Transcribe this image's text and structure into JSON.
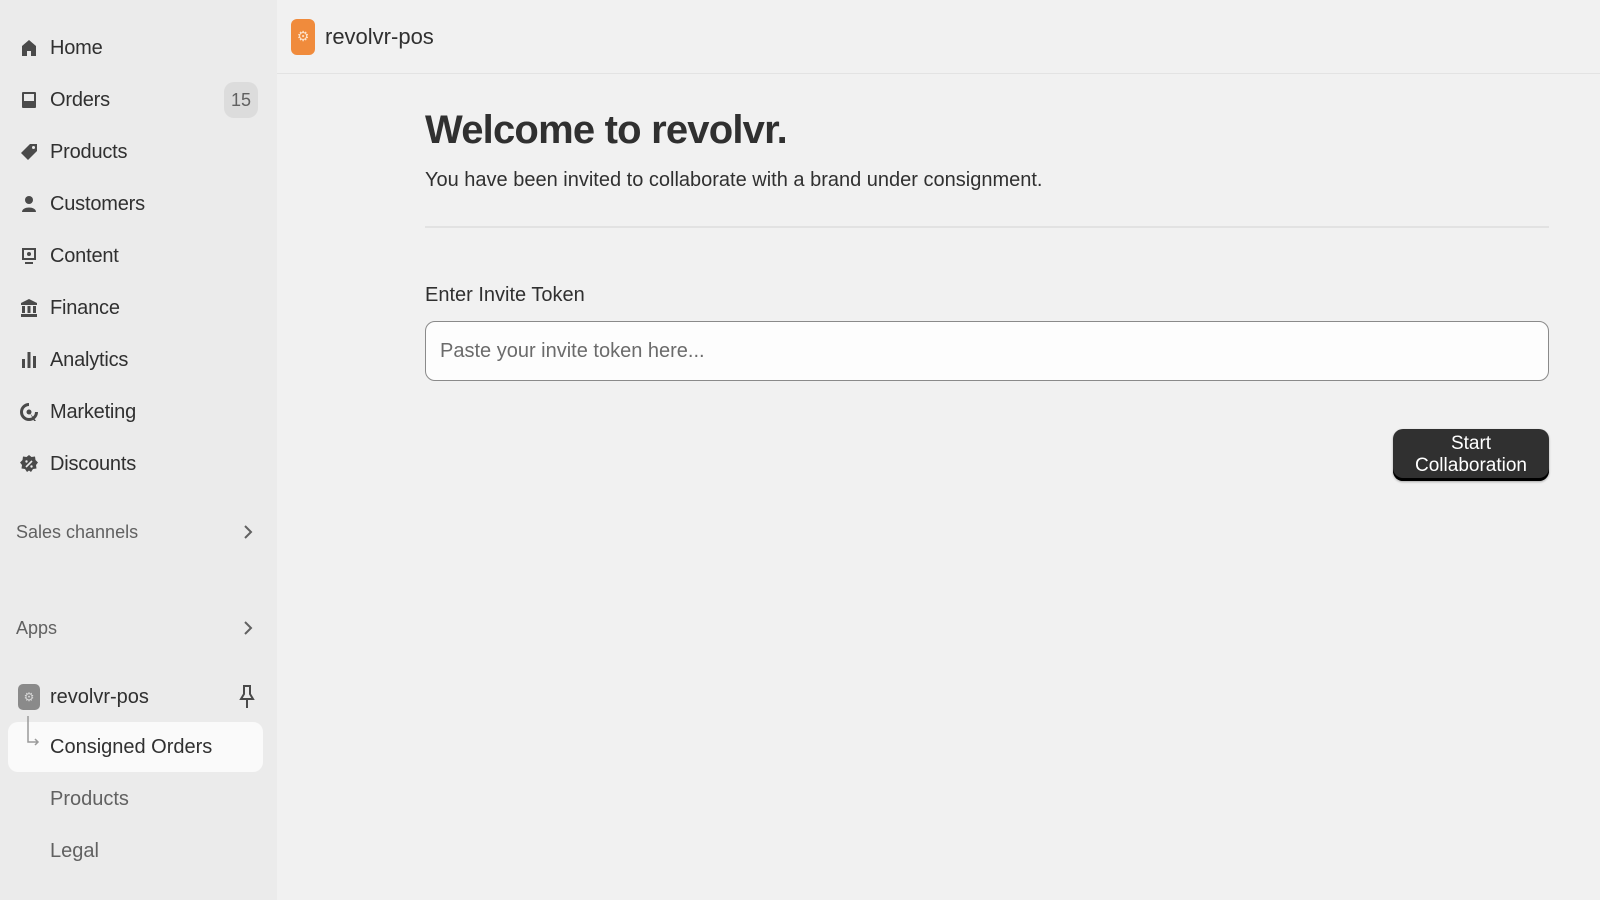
{
  "sidebar": {
    "items": [
      {
        "label": "Home",
        "icon": "home-icon"
      },
      {
        "label": "Orders",
        "icon": "orders-icon",
        "badge": "15"
      },
      {
        "label": "Products",
        "icon": "tag-icon"
      },
      {
        "label": "Customers",
        "icon": "person-icon"
      },
      {
        "label": "Content",
        "icon": "content-icon"
      },
      {
        "label": "Finance",
        "icon": "bank-icon"
      },
      {
        "label": "Analytics",
        "icon": "bar-chart-icon"
      },
      {
        "label": "Marketing",
        "icon": "target-icon"
      },
      {
        "label": "Discounts",
        "icon": "discount-icon"
      }
    ],
    "sales_channels": "Sales channels",
    "apps": "Apps",
    "app": {
      "name": "revolvr-pos",
      "icon": "app-icon",
      "sub_items": [
        {
          "label": "Consigned Orders",
          "active": true
        },
        {
          "label": "Products",
          "active": false
        },
        {
          "label": "Legal",
          "active": false
        }
      ]
    }
  },
  "header": {
    "title": "revolvr-pos",
    "logo_color": "#f08b3c"
  },
  "main": {
    "heading": "Welcome to revolvr.",
    "subtitle": "You have been invited to collaborate with a brand under consignment.",
    "field_label": "Enter Invite Token",
    "input_placeholder": "Paste your invite token here...",
    "input_value": "",
    "button_label": "Start Collaboration"
  }
}
